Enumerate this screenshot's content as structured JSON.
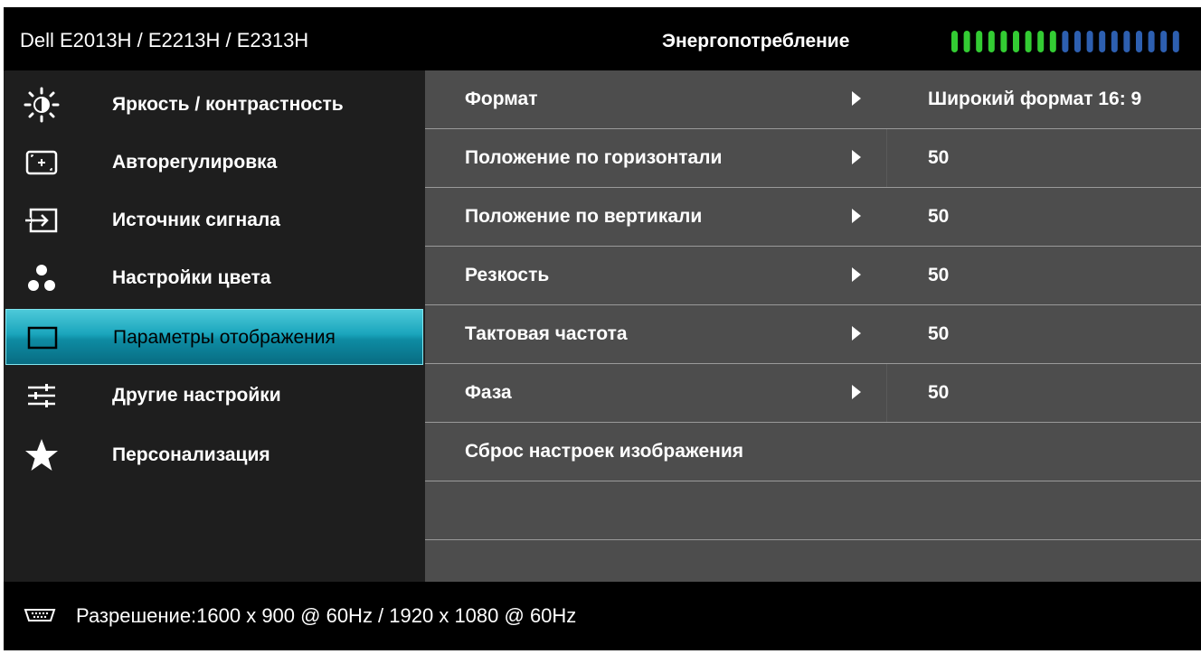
{
  "header": {
    "model": "Dell E2013H / E2213H / E2313H",
    "energy_label": "Энергопотребление",
    "energy_level": 0.47,
    "energy_colors": {
      "on": "#33cc33",
      "off": "#2d5fb0"
    }
  },
  "sidebar": {
    "items": [
      {
        "icon": "brightness-icon",
        "label": "Яркость / контрастность"
      },
      {
        "icon": "auto-adjust-icon",
        "label": "Авторегулировка"
      },
      {
        "icon": "input-source-icon",
        "label": "Источник сигнала"
      },
      {
        "icon": "color-settings-icon",
        "label": "Настройки цвета"
      },
      {
        "icon": "display-settings-icon",
        "label": "Параметры отображения",
        "active": true
      },
      {
        "icon": "other-settings-icon",
        "label": "Другие настройки"
      },
      {
        "icon": "star-icon",
        "label": "Персонализация"
      }
    ],
    "active_color": "#1aa5bc"
  },
  "panel": {
    "rows": [
      {
        "label": "Формат",
        "value": "Широкий формат 16:  9"
      },
      {
        "label": "Положение по горизонтали",
        "value": "50"
      },
      {
        "label": "Положение по вертикали",
        "value": "50"
      },
      {
        "label": "Резкость",
        "value": "50"
      },
      {
        "label": "Тактовая частота",
        "value": "50"
      },
      {
        "label": "Фаза",
        "value": "50"
      },
      {
        "label": "Сброс настроек изображения"
      }
    ]
  },
  "footer": {
    "icon": "vga-connector-icon",
    "resolution": "Разрешение:1600 x 900 @ 60Hz / 1920 x 1080 @ 60Hz"
  }
}
